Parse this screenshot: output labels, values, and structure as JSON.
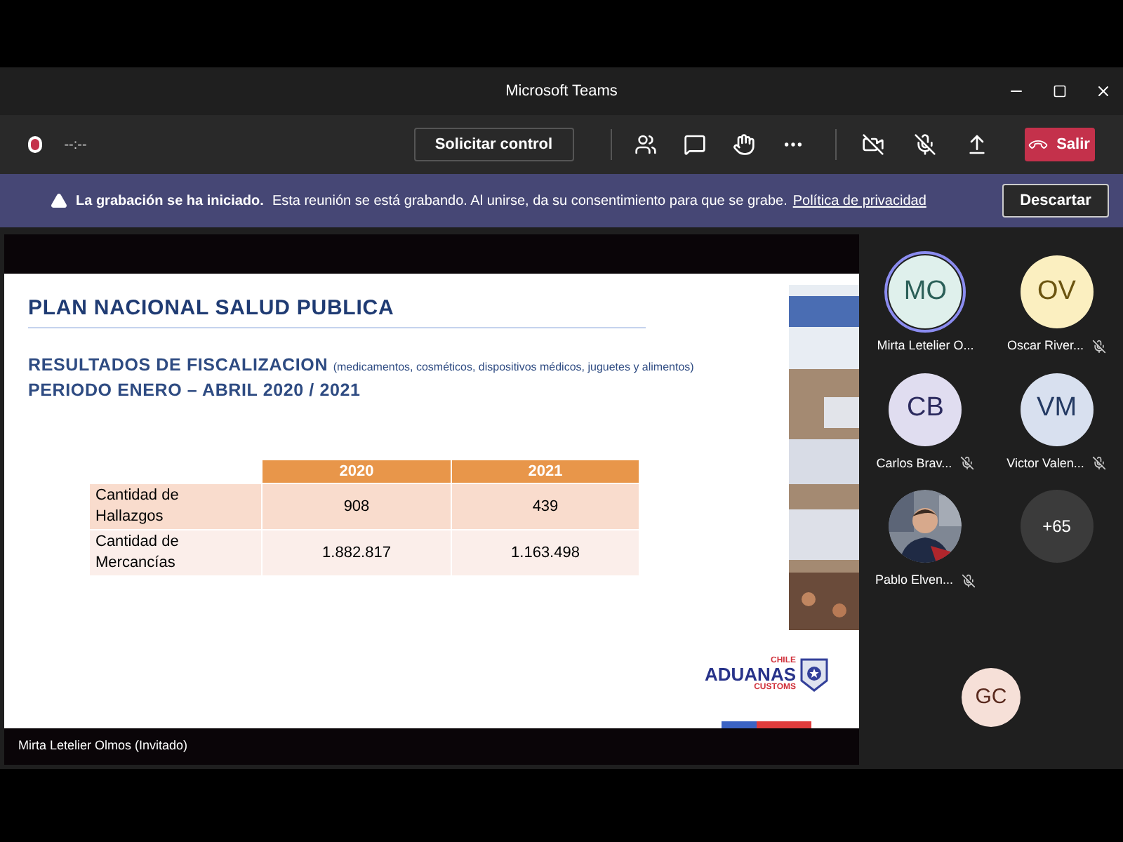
{
  "window": {
    "title": "Microsoft Teams"
  },
  "toolbar": {
    "timer": "--:--",
    "recording": true,
    "request_control": "Solicitar control",
    "leave": "Salir"
  },
  "banner": {
    "title": "La grabación se ha iniciado.",
    "message": "Esta reunión se está grabando. Al unirse, da su consentimiento para que se grabe.",
    "link": "Política de privacidad",
    "dismiss": "Descartar"
  },
  "slide": {
    "title": "PLAN NACIONAL SALUD PUBLICA",
    "subtitle": "RESULTADOS DE FISCALIZACION",
    "subtitle_note": "(medicamentos, cosméticos, dispositivos médicos, juguetes y alimentos)",
    "period": "PERIODO ENERO – ABRIL 2020 / 2021",
    "table": {
      "columns": [
        "2020",
        "2021"
      ],
      "rows": [
        {
          "label": "Cantidad de Hallazgos",
          "values": [
            "908",
            "439"
          ]
        },
        {
          "label": "Cantidad de Mercancías",
          "values": [
            "1.882.817",
            "1.163.498"
          ]
        }
      ]
    },
    "logo": {
      "top": "CHILE",
      "main": "ADUANAS",
      "bottom": "CUSTOMS"
    }
  },
  "presenter": "Mirta Letelier Olmos (Invitado)",
  "participants": [
    {
      "kind": "avatar",
      "initials": "MO",
      "name": "Mirta Letelier O...",
      "color": "#dff0ec",
      "speaking": true,
      "muted": false
    },
    {
      "kind": "avatar",
      "initials": "OV",
      "name": "Oscar River...",
      "color": "#fbefc0",
      "speaking": false,
      "muted": true
    },
    {
      "kind": "avatar",
      "initials": "CB",
      "name": "Carlos Brav...",
      "color": "#e0ddf0",
      "speaking": false,
      "muted": true
    },
    {
      "kind": "avatar",
      "initials": "VM",
      "name": "Victor Valen...",
      "color": "#d8e0ef",
      "speaking": false,
      "muted": true
    },
    {
      "name": "Pablo Elven...",
      "speaking": false,
      "muted": true
    },
    {
      "kind": "overflow",
      "label": "+65"
    }
  ],
  "self_view": {
    "initials": "GC"
  }
}
